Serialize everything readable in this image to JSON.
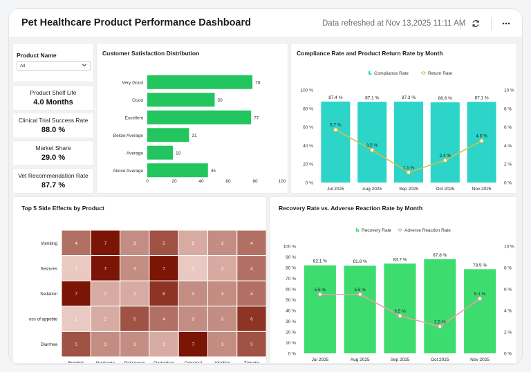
{
  "header": {
    "title": "Pet Healthcare Product Performance Dashboard",
    "refreshed": "Data refreshed at Nov 13,2025 11:11 AM",
    "refresh_icon": "refresh-icon",
    "more_icon": "more-horizontal-icon"
  },
  "filter": {
    "label": "Product Name",
    "value": "All",
    "icon": "chevron-down-icon"
  },
  "kpis": [
    {
      "label": "Product Shelf Life",
      "value": "4.0 Months"
    },
    {
      "label": "Clinical Trial Success Rate",
      "value": "88.0 %"
    },
    {
      "label": "Market Share",
      "value": "29.0 %"
    },
    {
      "label": "Vet Recommendation Rate",
      "value": "87.7 %"
    }
  ],
  "satisfaction": {
    "title": "Customer Satisfaction Distribution"
  },
  "compliance": {
    "title": "Compliance Rate and Product Return Rate by Month"
  },
  "side_effects": {
    "title": "Top 5 Side Effects by Product"
  },
  "recovery": {
    "title": "Recovery Rate vs. Adverse Reaction Rate by Month"
  },
  "colors": {
    "satisfaction_bar": "#22c55e",
    "compliance_bar": "#2dd4c8",
    "return_line": "#d4c04a",
    "recovery_bar": "#3ddc6e",
    "adverse_line": "#e8a0aa",
    "heat_low": "#e9c9c1",
    "heat_high": "#7b1606"
  },
  "chart_data": [
    {
      "type": "bar",
      "orientation": "horizontal",
      "title": "Customer Satisfaction Distribution",
      "categories": [
        "Very Good",
        "Good",
        "Excellent",
        "Below Average",
        "Average",
        "Above Average"
      ],
      "values": [
        78,
        50,
        77,
        31,
        19,
        45
      ],
      "xticks": [
        "0",
        "20",
        "40",
        "60",
        "80",
        "100"
      ],
      "xlim": [
        0,
        100
      ]
    },
    {
      "type": "bar",
      "title": "Compliance Rate and Product Return Rate by Month",
      "categories": [
        "Jul 2025",
        "Aug 2025",
        "Sep 2025",
        "Oct 2025",
        "Nov 2025"
      ],
      "series": [
        {
          "name": "Compliance Rate",
          "type": "bar",
          "axis": "left",
          "values": [
            87.4,
            87.1,
            87.3,
            86.6,
            87.1
          ],
          "labels": [
            "87.4 %",
            "87.1 %",
            "87.3 %",
            "86.6 %",
            "87.1 %"
          ]
        },
        {
          "name": "Return Rate",
          "type": "line",
          "axis": "right",
          "values": [
            5.7,
            3.5,
            1.1,
            2.4,
            4.5
          ],
          "labels": [
            "5.7 %",
            "3.5 %",
            "1.1 %",
            "2.4 %",
            "4.5 %"
          ]
        }
      ],
      "yticks_left": [
        "0 %",
        "20 %",
        "40 %",
        "60 %",
        "80 %",
        "100 %"
      ],
      "yticks_right": [
        "0 %",
        "2 %",
        "4 %",
        "6 %",
        "8 %",
        "10 %"
      ],
      "ylim_left": [
        0,
        100
      ],
      "ylim_right": [
        0,
        10
      ],
      "legend": "top-center"
    },
    {
      "type": "heatmap",
      "title": "Top 5 Side Effects by Product",
      "x": [
        "Bomitrin",
        "Noolange",
        "Paksenum",
        "Qartophan",
        "Quinapel",
        "Vinellen",
        "Zomotix"
      ],
      "y": [
        "Vomiting",
        "Seizures",
        "Sedation",
        "oss of appetite",
        "Diarrhea"
      ],
      "values": [
        [
          4,
          7,
          3,
          5,
          2,
          3,
          4
        ],
        [
          1,
          7,
          3,
          7,
          1,
          2,
          4
        ],
        [
          7,
          2,
          2,
          6,
          3,
          3,
          4
        ],
        [
          1,
          2,
          5,
          4,
          3,
          3,
          6
        ],
        [
          5,
          3,
          3,
          2,
          7,
          3,
          5
        ]
      ],
      "value_range": [
        1,
        7
      ]
    },
    {
      "type": "bar",
      "title": "Recovery Rate vs. Adverse Reaction Rate by Month",
      "categories": [
        "Jul 2025",
        "Aug 2025",
        "Sep 2025",
        "Oct 2025",
        "Nov 2025"
      ],
      "series": [
        {
          "name": "Recovery Rate",
          "type": "bar",
          "axis": "left",
          "values": [
            82.1,
            81.8,
            83.7,
            87.8,
            78.5
          ],
          "labels": [
            "82.1 %",
            "81.8 %",
            "83.7 %",
            "87.8 %",
            "78.5 %"
          ]
        },
        {
          "name": "Adverse Reaction Rate",
          "type": "line",
          "axis": "right",
          "values": [
            5.5,
            5.5,
            3.5,
            2.5,
            5.1
          ],
          "labels": [
            "5.5 %",
            "5.5 %",
            "3.5 %",
            "2.5 %",
            "5.1 %"
          ]
        }
      ],
      "yticks_left": [
        "0 %",
        "10 %",
        "20 %",
        "30 %",
        "40 %",
        "50 %",
        "60 %",
        "70 %",
        "80 %",
        "90 %",
        "100 %"
      ],
      "yticks_right": [
        "0 %",
        "2 %",
        "4 %",
        "6 %",
        "8 %",
        "10 %"
      ],
      "ylim_left": [
        0,
        100
      ],
      "ylim_right": [
        0,
        10
      ],
      "legend": "top-center"
    }
  ]
}
